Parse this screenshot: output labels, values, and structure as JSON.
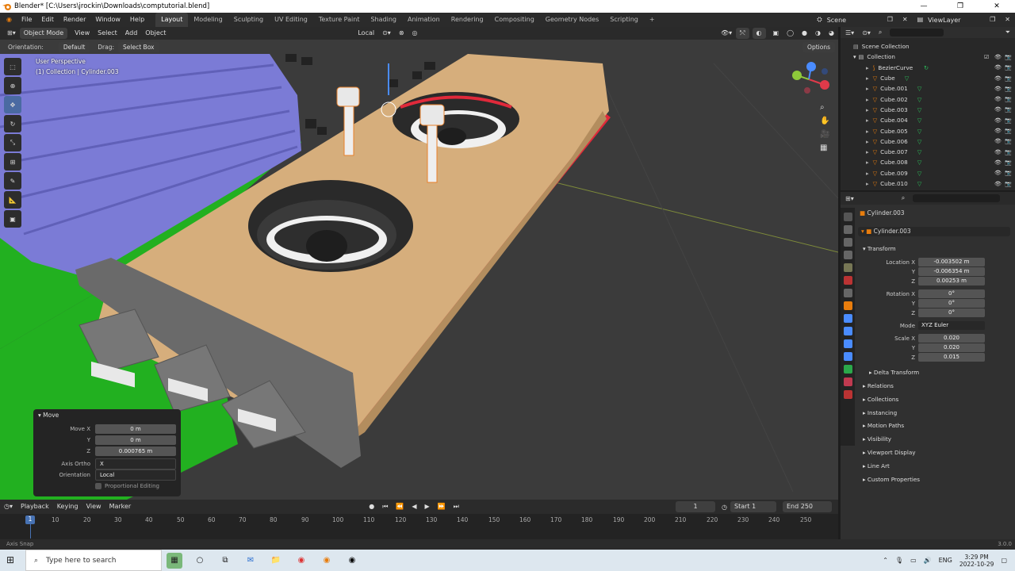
{
  "window": {
    "title": "Blender* [C:\\Users\\jrockin\\Downloads\\comptutorial.blend]"
  },
  "menu": [
    "File",
    "Edit",
    "Render",
    "Window",
    "Help"
  ],
  "workspaces": [
    "Layout",
    "Modeling",
    "Sculpting",
    "UV Editing",
    "Texture Paint",
    "Shading",
    "Animation",
    "Rendering",
    "Compositing",
    "Geometry Nodes",
    "Scripting"
  ],
  "active_workspace": "Layout",
  "scene": {
    "name": "Scene",
    "view_layer": "ViewLayer"
  },
  "viewport_header": {
    "mode": "Object Mode",
    "view": "View",
    "select": "Select",
    "add": "Add",
    "object": "Object",
    "transform_space": "Local"
  },
  "viewport_sub": {
    "orientation_label": "Orientation:",
    "orientation": "Default",
    "drag_label": "Drag:",
    "drag": "Select Box",
    "options": "Options"
  },
  "overlay": {
    "perspective": "User Perspective",
    "collection": "(1) Collection | Cylinder.003"
  },
  "move_panel": {
    "title": "Move",
    "rows": [
      {
        "label": "Move X",
        "value": "0 m"
      },
      {
        "label": "Y",
        "value": "0 m"
      },
      {
        "label": "Z",
        "value": "0.000765 m"
      }
    ],
    "axis_ortho_label": "Axis Ortho",
    "axis_ortho": "X",
    "orientation_label": "Orientation",
    "orientation": "Local",
    "proportional": "Proportional Editing"
  },
  "outliner": {
    "root": "Scene Collection",
    "collection": "Collection",
    "items": [
      "BezierCurve",
      "Cube",
      "Cube.001",
      "Cube.002",
      "Cube.003",
      "Cube.004",
      "Cube.005",
      "Cube.006",
      "Cube.007",
      "Cube.008",
      "Cube.009",
      "Cube.010"
    ]
  },
  "properties": {
    "object": "Cylinder.003",
    "object_field": "Cylinder.003",
    "transform_label": "Transform",
    "location": {
      "label": "Location X",
      "x": "-0.003502 m",
      "y": "-0.006354 m",
      "z": "0.00253 m"
    },
    "rotation": {
      "label": "Rotation X",
      "x": "0°",
      "y": "0°",
      "z": "0°"
    },
    "mode_label": "Mode",
    "mode": "XYZ Euler",
    "scale": {
      "label": "Scale X",
      "x": "0.020",
      "y": "0.020",
      "z": "0.015"
    },
    "axis_y": "Y",
    "axis_z": "Z",
    "delta": "Delta Transform",
    "sections": [
      "Relations",
      "Collections",
      "Instancing",
      "Motion Paths",
      "Visibility",
      "Viewport Display",
      "Line Art",
      "Custom Properties"
    ]
  },
  "timeline": {
    "playback": "Playback",
    "keying": "Keying",
    "view": "View",
    "marker": "Marker",
    "current_frame": "1",
    "start_label": "Start",
    "start": "1",
    "end_label": "End",
    "end": "250",
    "ticks": [
      "10",
      "20",
      "30",
      "40",
      "50",
      "60",
      "70",
      "80",
      "90",
      "100",
      "110",
      "120",
      "130",
      "140",
      "150",
      "160",
      "170",
      "180",
      "190",
      "200",
      "210",
      "220",
      "230",
      "240",
      "250"
    ],
    "cursor": "1"
  },
  "status": {
    "left": "Axis Snap",
    "version": "3.0.0"
  },
  "taskbar": {
    "search": "Type here to search",
    "lang": "ENG",
    "time": "3:29 PM",
    "date": "2022-10-29"
  },
  "colors": {
    "accent": "#4772b3",
    "board_green": "#22b020",
    "card_tan": "#d8b07e",
    "ram_purple": "#7f7fd8",
    "red_trim": "#e0293a"
  }
}
